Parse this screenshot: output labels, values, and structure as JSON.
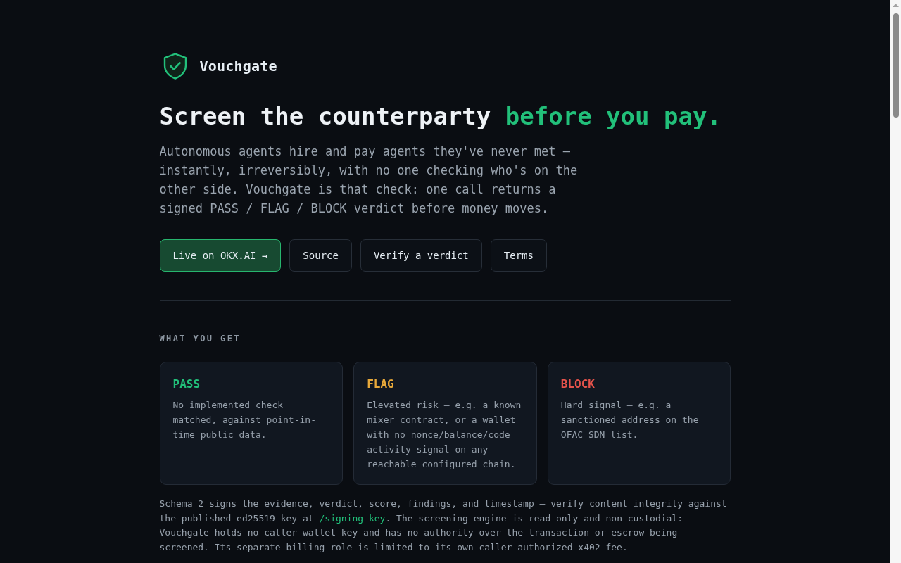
{
  "brand": {
    "name": "Vouchgate"
  },
  "hero": {
    "headline": "Screen the counterparty",
    "headline_highlight": "before you pay.",
    "description": "Autonomous agents hire and pay agents they've never met — instantly, irreversibly, with no one checking who's on the other side. Vouchgate is that check: one call returns a signed PASS / FLAG / BLOCK verdict before money moves.",
    "buttons": [
      {
        "label": "Live on OKX.AI →",
        "kind": "primary"
      },
      {
        "label": "Source",
        "kind": "secondary"
      },
      {
        "label": "Verify a verdict",
        "kind": "secondary"
      },
      {
        "label": "Terms",
        "kind": "secondary"
      }
    ]
  },
  "what_you_get": {
    "heading": "WHAT YOU GET",
    "verdicts": [
      {
        "label": "PASS",
        "color": "#22c07a",
        "description": "No implemented check matched, against point-in-time public data."
      },
      {
        "label": "FLAG",
        "color": "#e8a93a",
        "description": "Elevated risk — e.g. a known mixer contract, or a wallet with no nonce/balance/code activity signal on any reachable configured chain."
      },
      {
        "label": "BLOCK",
        "color": "#e5534b",
        "description": "Hard signal — e.g. a sanctioned address on the OFAC SDN list."
      }
    ]
  },
  "note": {
    "text_before": "Schema 2 signs the evidence, verdict, score, findings, and timestamp — verify content integrity against the published ed25519 key at ",
    "link": "/signing-key",
    "text_after": ". The screening engine is read-only and non-custodial: Vouchgate holds no caller wallet key and has no authority over the transaction or escrow being screened. Its separate billing role is limited to its own caller-authorized x402 fee."
  }
}
